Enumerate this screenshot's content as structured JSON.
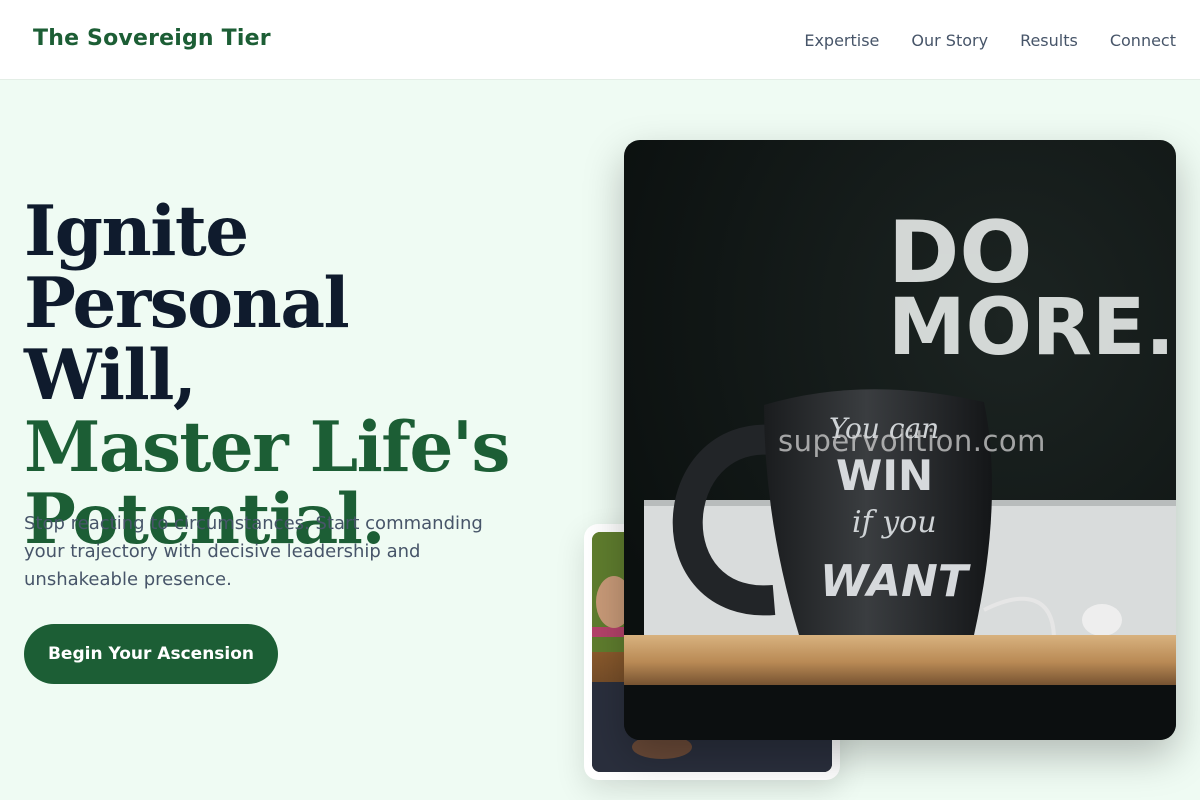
{
  "brand": {
    "name": "The Sovereign Tier",
    "accent": "#1c5e35"
  },
  "nav": {
    "links": [
      {
        "label": "Expertise"
      },
      {
        "label": "Our Story"
      },
      {
        "label": "Results"
      },
      {
        "label": "Connect"
      }
    ]
  },
  "hero": {
    "title_line1": "Ignite Personal",
    "title_line2": "Will,",
    "title_accent_line1": "Master Life's",
    "title_accent_line2": "Potential.",
    "subtitle": "Stop reacting to circumstances. Start commanding your trajectory with decisive leadership and unshakeable presence.",
    "cta_label": "Begin Your Ascension"
  },
  "images": {
    "main_photo": {
      "sign_line1": "DO",
      "sign_line2": "MORE.",
      "mug_line1": "You can",
      "mug_line2": "WIN",
      "mug_line3": "if you",
      "mug_line4": "WANT"
    },
    "secondary_photo": "person-with-phone-photo"
  },
  "watermark": "supervolition.com"
}
